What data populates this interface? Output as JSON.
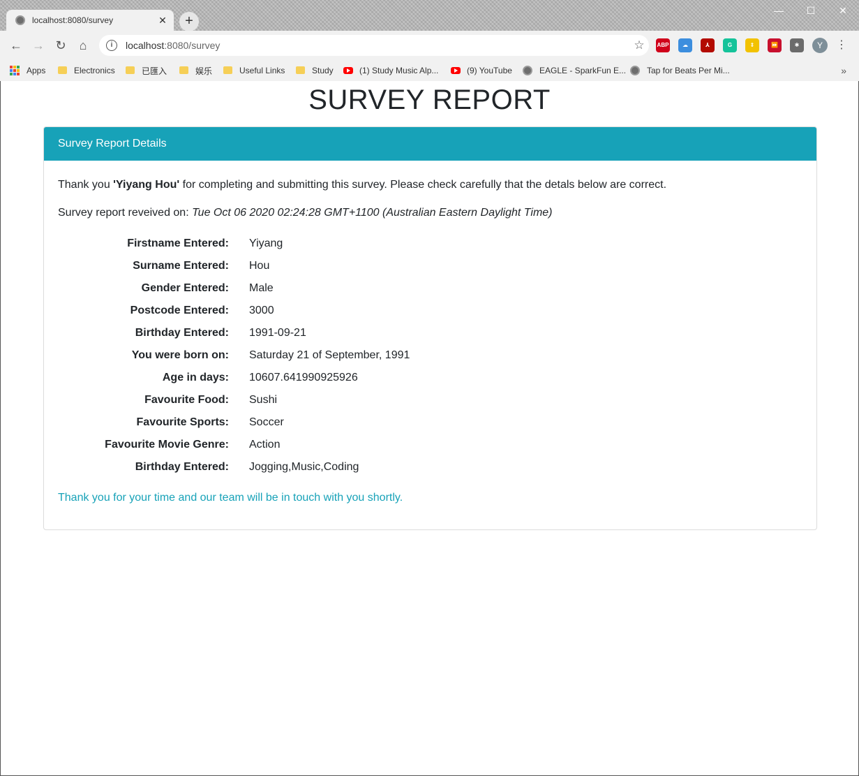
{
  "browser": {
    "tab_title": "localhost:8080/survey",
    "tab_close": "✕",
    "new_tab": "+",
    "url_host": "localhost",
    "url_rest": ":8080/survey",
    "window_controls": {
      "minimize": "—",
      "maximize": "☐",
      "close": "✕"
    },
    "bookmarks": [
      {
        "label": "Apps",
        "icon": "apps-grid-icon"
      },
      {
        "label": "Electronics",
        "icon": "folder-icon"
      },
      {
        "label": "已匯入",
        "icon": "folder-icon"
      },
      {
        "label": "娱乐",
        "icon": "folder-icon"
      },
      {
        "label": "Useful Links",
        "icon": "folder-icon"
      },
      {
        "label": "Study",
        "icon": "folder-icon"
      },
      {
        "label": "(1) Study Music Alp...",
        "icon": "youtube-icon"
      },
      {
        "label": "(9) YouTube",
        "icon": "youtube-icon"
      },
      {
        "label": "EAGLE - SparkFun E...",
        "icon": "globe-icon"
      },
      {
        "label": "Tap for Beats Per Mi...",
        "icon": "globe-icon"
      }
    ],
    "bookmarks_more": "»",
    "extensions": [
      {
        "name": "adblock-icon",
        "text": "ABP",
        "color": "#d0021b"
      },
      {
        "name": "icloud-icon",
        "text": "☁",
        "color": "#3c8ede"
      },
      {
        "name": "pdf-icon",
        "text": "⅄",
        "color": "#b30b00"
      },
      {
        "name": "grammarly-icon",
        "text": "G",
        "color": "#15c39a"
      },
      {
        "name": "arrows-icon",
        "text": "⇕",
        "color": "#f2c200"
      },
      {
        "name": "media-icon",
        "text": "⏩",
        "color": "#c8102e"
      },
      {
        "name": "puzzle-icon",
        "text": "✱",
        "color": "#6b6b6b"
      }
    ],
    "profile_initial": "Y"
  },
  "page": {
    "title": "SURVEY REPORT",
    "card_header": "Survey Report Details",
    "intro_prefix": "Thank you ",
    "intro_name": "'Yiyang Hou'",
    "intro_suffix": " for completing and submitting this survey. Please check carefully that the detals below are correct.",
    "received_prefix": "Survey report reveived on: ",
    "received_date": "Tue Oct 06 2020 02:24:28 GMT+1100 (Australian Eastern Daylight Time)",
    "details": [
      {
        "label": "Firstname Entered:",
        "value": "Yiyang"
      },
      {
        "label": "Surname Entered:",
        "value": "Hou"
      },
      {
        "label": "Gender Entered:",
        "value": "Male"
      },
      {
        "label": "Postcode Entered:",
        "value": "3000"
      },
      {
        "label": "Birthday Entered:",
        "value": "1991-09-21"
      },
      {
        "label": "You were born on:",
        "value": "Saturday 21 of September, 1991"
      },
      {
        "label": "Age in days:",
        "value": "10607.641990925926"
      },
      {
        "label": "Favourite Food:",
        "value": "Sushi"
      },
      {
        "label": "Favourite Sports:",
        "value": "Soccer"
      },
      {
        "label": "Favourite Movie Genre:",
        "value": "Action"
      },
      {
        "label": "Birthday Entered:",
        "value": "Jogging,Music,Coding"
      }
    ],
    "closing": "Thank you for your time and our team will be in touch with you shortly."
  },
  "colors": {
    "accent": "#17a2b8",
    "text": "#212529"
  }
}
